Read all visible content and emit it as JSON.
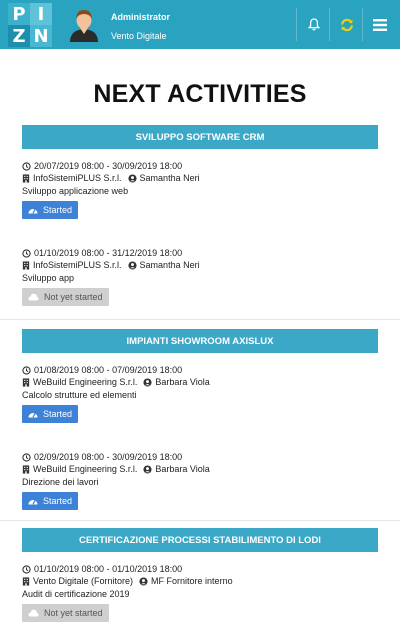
{
  "topbar": {
    "logo_letters": [
      "P",
      "I",
      "Z",
      "N"
    ],
    "user_name": "Administrator",
    "user_company": "Vento Digitale",
    "icons": [
      "bell-icon",
      "sync-icon",
      "menu-icon"
    ],
    "colors": {
      "bar": "#2aa3c1",
      "sync_icon": "#f4d000"
    }
  },
  "page_title": "NEXT ACTIVITIES",
  "sections": [
    {
      "title": "SVILUPPO SOFTWARE CRM",
      "activities": [
        {
          "period": "20/07/2019 08:00 - 30/09/2019 18:00",
          "company": "InfoSistemiPLUS S.r.l.",
          "person": "Samantha Neri",
          "description": "Sviluppo applicazione web",
          "status": "Started"
        },
        {
          "period": "01/10/2019 08:00 - 31/12/2019 18:00",
          "company": "InfoSistemiPLUS S.r.l.",
          "person": "Samantha Neri",
          "description": "Sviluppo app",
          "status": "Not yet started"
        }
      ]
    },
    {
      "title": "IMPIANTI SHOWROOM AXISLUX",
      "activities": [
        {
          "period": "01/08/2019 08:00 - 07/09/2019 18:00",
          "company": "WeBuild Engineering S.r.l.",
          "person": "Barbara Viola",
          "description": "Calcolo strutture ed elementi",
          "status": "Started"
        },
        {
          "period": "02/09/2019 08:00 - 30/09/2019 18:00",
          "company": "WeBuild Engineering S.r.l.",
          "person": "Barbara Viola",
          "description": "Direzione dei lavori",
          "status": "Started"
        }
      ]
    },
    {
      "title": "CERTIFICAZIONE PROCESSI STABILIMENTO DI LODI",
      "activities": [
        {
          "period": "01/10/2019 08:00 - 01/10/2019 18:00",
          "company": "Vento Digitale (Fornitore)",
          "person": "MF Fornitore interno",
          "description": "Audit di certificazione 2019",
          "status": "Not yet started"
        }
      ]
    }
  ],
  "status_colors": {
    "started": "#3e82d8",
    "not_started": "#cfcfcf"
  }
}
